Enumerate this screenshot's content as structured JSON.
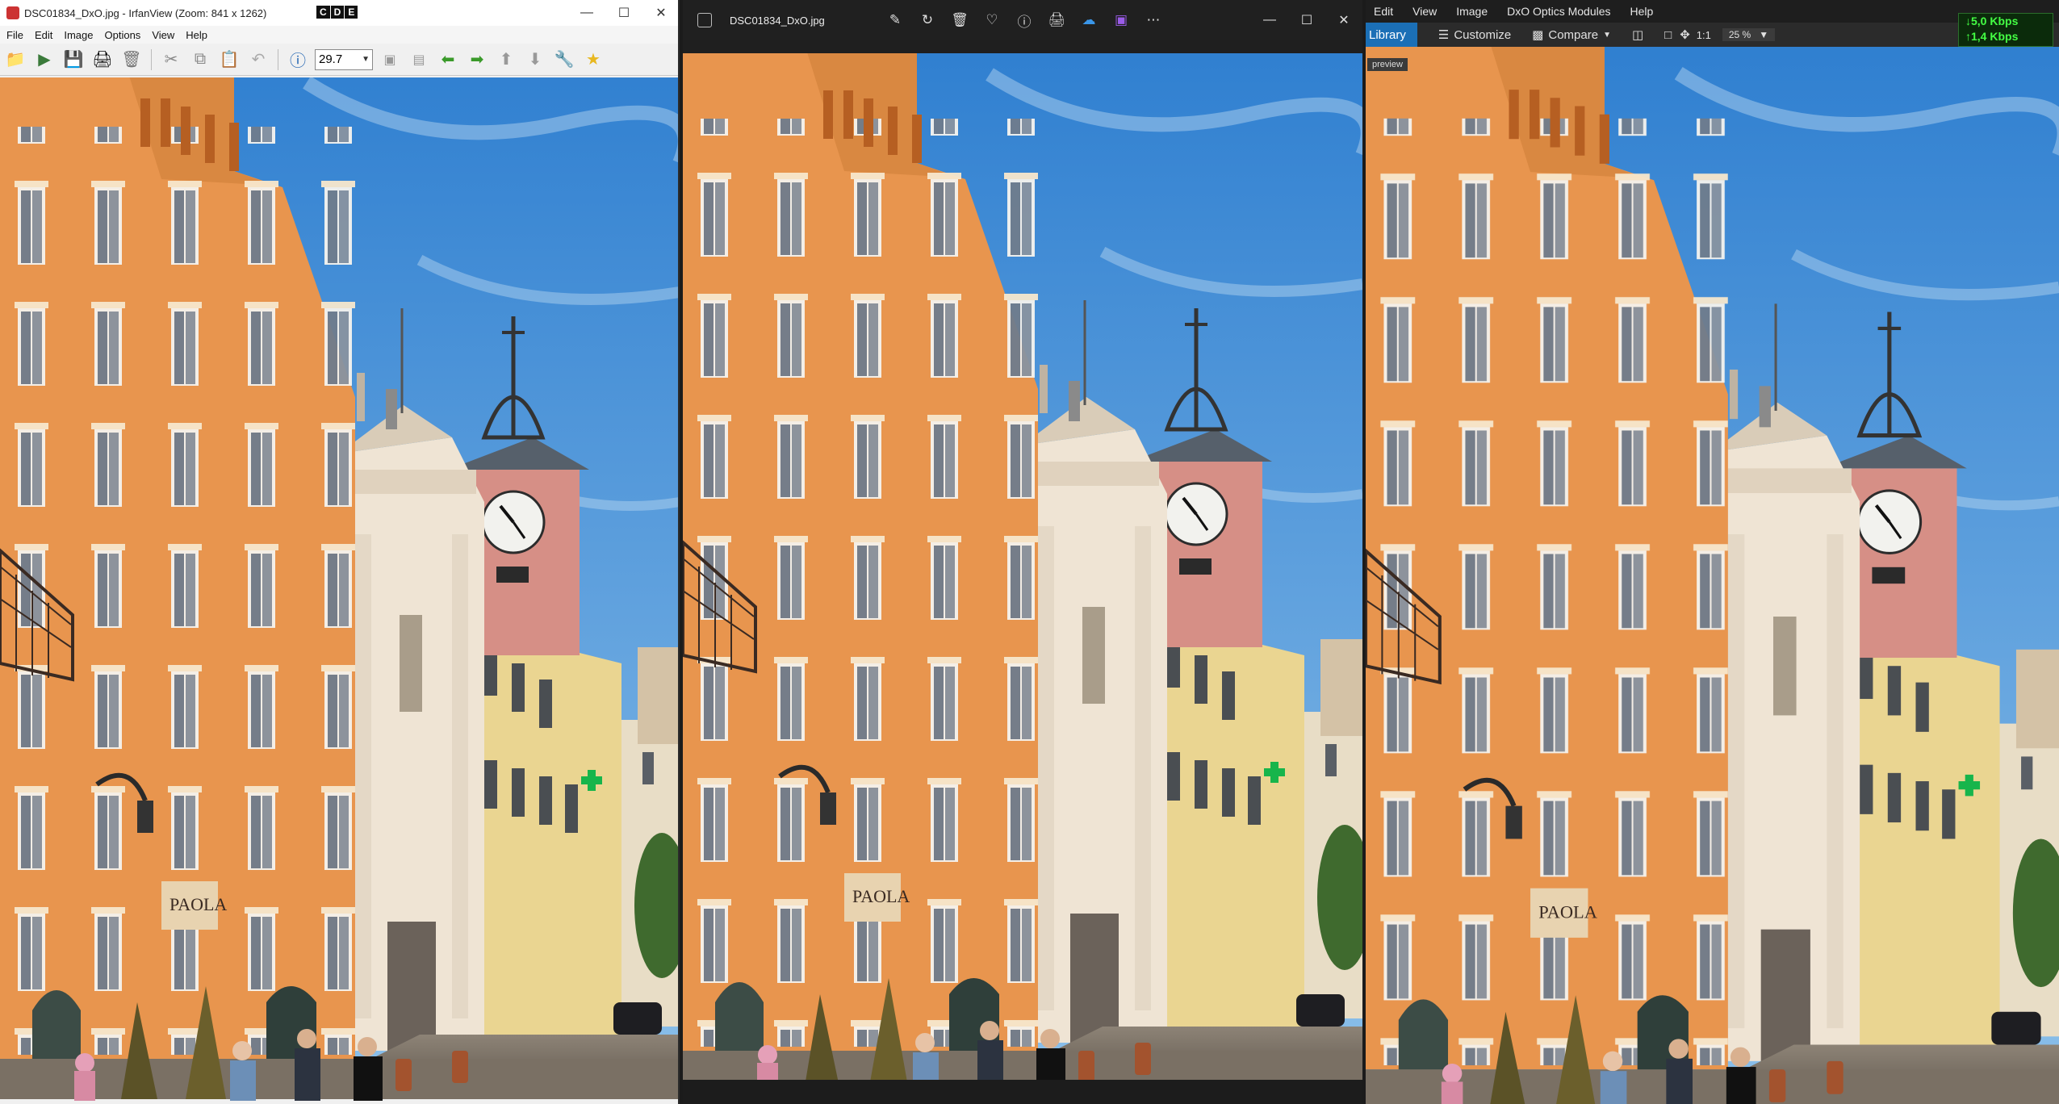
{
  "irfanview": {
    "title": "DSC01834_DxO.jpg - IrfanView (Zoom: 841 x 1262)",
    "cde_badge": [
      "C",
      "D",
      "E"
    ],
    "menu": [
      "File",
      "Edit",
      "Image",
      "Options",
      "View",
      "Help"
    ],
    "zoom_value": "29.7",
    "toolbar_icons": [
      "open-folder-icon",
      "slideshow-icon",
      "save-icon",
      "print-icon",
      "delete-icon",
      "cut-icon",
      "copy-icon",
      "paste-icon",
      "undo-icon",
      "info-icon",
      "fit-icon",
      "minimize-icon",
      "previous-icon",
      "next-icon",
      "up-icon",
      "down-icon",
      "settings-icon",
      "favorite-icon"
    ]
  },
  "photos": {
    "title": "DSC01834_DxO.jpg",
    "actions": [
      "edit-icon",
      "rotate-icon",
      "delete-icon",
      "favorite-icon",
      "info-icon",
      "print-icon",
      "onedrive-icon",
      "clipchamp-icon",
      "more-icon"
    ]
  },
  "dxo": {
    "menu": [
      "Edit",
      "View",
      "Image",
      "DxO Optics Modules",
      "Help"
    ],
    "tab_library": "Library",
    "customize_label": "Customize",
    "compare_label": "Compare",
    "ratio_label": "1:1",
    "zoom_value": "25 %",
    "tooltip": "preview",
    "net_down": "5,0 Kbps",
    "net_up": "1,4 Kbps"
  },
  "colors": {
    "sky": "#3d8fd6",
    "facade_orange": "#e9974e",
    "dxo_accent": "#1b6fb6"
  }
}
